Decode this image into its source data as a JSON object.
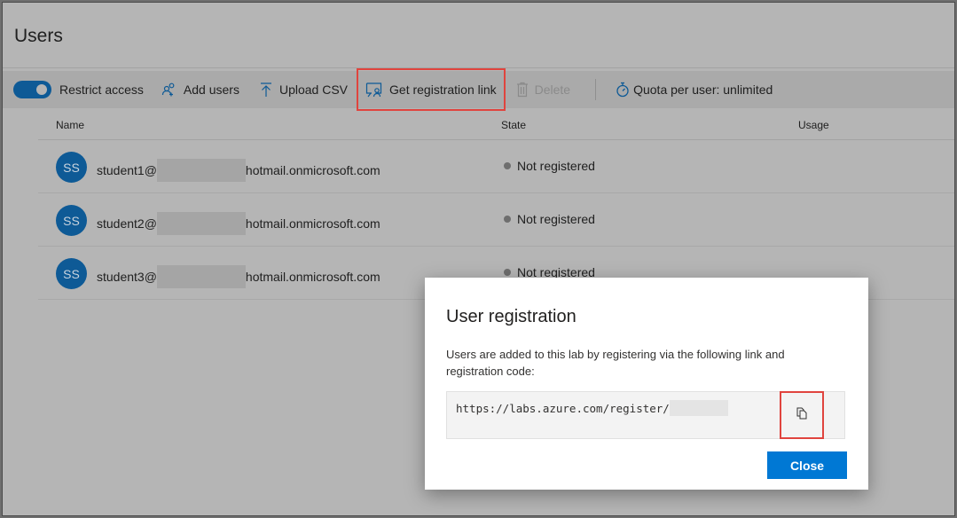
{
  "page": {
    "title": "Users"
  },
  "toolbar": {
    "restrict_access": {
      "label": "Restrict access",
      "on": true
    },
    "add_users": "Add users",
    "upload_csv": "Upload CSV",
    "get_registration_link": "Get registration link",
    "delete": "Delete",
    "quota": "Quota per user: unlimited"
  },
  "table": {
    "columns": [
      "Name",
      "State",
      "Usage"
    ],
    "rows": [
      {
        "initials": "SS",
        "email_prefix": "student1@",
        "email_suffix": "hotmail.onmicrosoft.com",
        "state": "Not registered"
      },
      {
        "initials": "SS",
        "email_prefix": "student2@",
        "email_suffix": "hotmail.onmicrosoft.com",
        "state": "Not registered"
      },
      {
        "initials": "SS",
        "email_prefix": "student3@",
        "email_suffix": "hotmail.onmicrosoft.com",
        "state": "Not registered"
      }
    ]
  },
  "modal": {
    "title": "User registration",
    "description": "Users are added to this lab by registering via the following link and registration code:",
    "link": "https://labs.azure.com/register/",
    "copy_icon": "copy-icon",
    "close_label": "Close"
  },
  "colors": {
    "accent": "#0078d4",
    "avatar": "#0e5a96",
    "highlight": "#e0443e"
  }
}
